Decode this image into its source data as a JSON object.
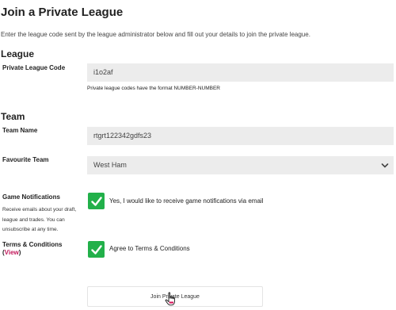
{
  "page": {
    "title": "Join a Private League",
    "intro": "Enter the league code sent by the league administrator below and fill out your details to join the private league."
  },
  "league_section": {
    "heading": "League",
    "code_label": "Private League Code",
    "code_value": "i1o2af",
    "code_hint": "Private league codes have the format NUMBER-NUMBER"
  },
  "team_section": {
    "heading": "Team",
    "name_label": "Team Name",
    "name_value": "rtgrt122342gdfs23",
    "favourite_label": "Favourite Team",
    "favourite_value": "West Ham"
  },
  "notifications": {
    "label": "Game Notifications",
    "description": "Receive emails about your draft, league and trades. You can unsubscribe at any time.",
    "checkbox_text": "Yes, I would like to receive game notifications via email",
    "checked": true
  },
  "terms": {
    "label": "Terms & Conditions",
    "paren_open": "(",
    "view_link": "View",
    "paren_close": ")",
    "checkbox_text": "Agree to Terms & Conditions",
    "checked": true
  },
  "submit": {
    "label": "Join Private League"
  },
  "colors": {
    "check": "#22b04a",
    "link": "#c2185b",
    "field_bg": "#ececec"
  }
}
